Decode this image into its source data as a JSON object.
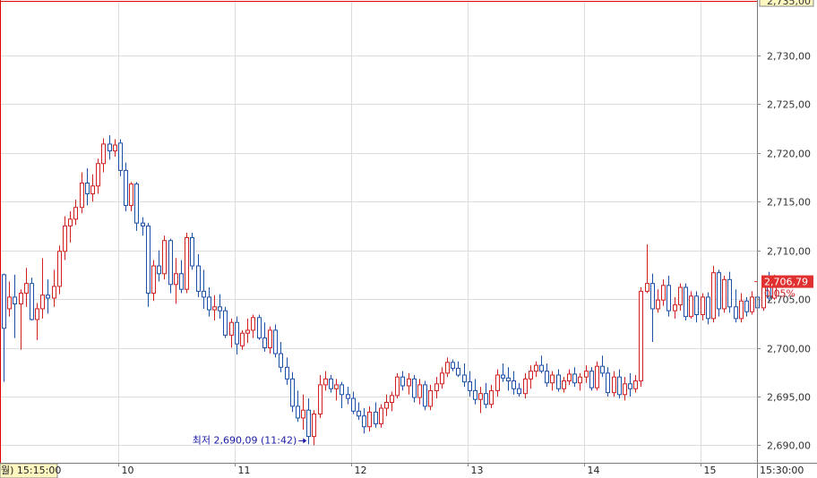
{
  "chart_data": {
    "type": "candlestick",
    "ylim": [
      2688.2,
      2735.5
    ],
    "y_ticks": [
      {
        "value": 2690,
        "label": "2,690,00"
      },
      {
        "value": 2695,
        "label": "2,695,00"
      },
      {
        "value": 2700,
        "label": "2,700,00"
      },
      {
        "value": 2705,
        "label": "2,705,00"
      },
      {
        "value": 2710,
        "label": "2,710,00"
      },
      {
        "value": 2715,
        "label": "2,715,00"
      },
      {
        "value": 2720,
        "label": "2,720,00"
      },
      {
        "value": 2725,
        "label": "2,725,00"
      },
      {
        "value": 2730,
        "label": "2,730,00"
      }
    ],
    "top_clipped_label": "2,735,00",
    "x_domain": [
      0,
      131
    ],
    "x_ticks": [
      {
        "index": 21,
        "label": "10"
      },
      {
        "index": 42,
        "label": "11"
      },
      {
        "index": 63,
        "label": "12"
      },
      {
        "index": 84,
        "label": "13"
      },
      {
        "index": 105,
        "label": "14"
      },
      {
        "index": 126,
        "label": "15"
      }
    ],
    "crosshair_time_label": "월) 15:15:00",
    "right_time_label": "15:30:00",
    "current_price": {
      "value": 2706.79,
      "label": "2,706,79",
      "change": "0.05%"
    },
    "min_annotation": {
      "index": 55,
      "value": 2690.09,
      "label": "최저 2,690,09 (11:42)"
    },
    "colors": {
      "up": "#d02020",
      "down": "#1c4fa8",
      "grid": "#dcdcdc",
      "frame": "#e00000",
      "price_tag_bg": "#e03030"
    },
    "series": [
      {
        "values": [
          [
            2707.5,
            2707.6,
            2696.5,
            2702.0
          ],
          [
            2704.0,
            2706.8,
            2703.2,
            2705.2
          ],
          [
            2705.2,
            2707.5,
            2701.0,
            2704.5
          ],
          [
            2704.5,
            2706.0,
            2699.8,
            2705.6
          ],
          [
            2705.6,
            2708.2,
            2704.2,
            2706.6
          ],
          [
            2706.6,
            2707.2,
            2702.8,
            2702.9
          ],
          [
            2702.9,
            2704.6,
            2700.8,
            2704.0
          ],
          [
            2704.0,
            2709.2,
            2703.0,
            2705.4
          ],
          [
            2705.4,
            2707.0,
            2703.5,
            2705.1
          ],
          [
            2705.1,
            2708.0,
            2704.2,
            2706.3
          ],
          [
            2706.3,
            2710.5,
            2705.5,
            2709.9
          ],
          [
            2709.9,
            2713.5,
            2709.0,
            2712.5
          ],
          [
            2712.5,
            2714.0,
            2710.8,
            2713.2
          ],
          [
            2713.2,
            2715.2,
            2712.6,
            2714.4
          ],
          [
            2714.4,
            2718.0,
            2713.8,
            2716.9
          ],
          [
            2716.9,
            2718.4,
            2714.6,
            2715.8
          ],
          [
            2715.8,
            2717.8,
            2715.0,
            2716.6
          ],
          [
            2716.6,
            2719.4,
            2715.8,
            2718.9
          ],
          [
            2718.9,
            2721.5,
            2718.0,
            2720.9
          ],
          [
            2720.9,
            2721.8,
            2719.3,
            2720.2
          ],
          [
            2720.2,
            2721.4,
            2719.6,
            2720.8
          ]
        ]
      },
      {
        "values": [
          [
            2721.0,
            2721.4,
            2717.6,
            2718.2
          ],
          [
            2718.2,
            2719.0,
            2714.0,
            2714.6
          ],
          [
            2714.6,
            2717.0,
            2714.0,
            2716.8
          ],
          [
            2716.8,
            2717.0,
            2712.0,
            2712.8
          ],
          [
            2712.8,
            2713.4,
            2711.5,
            2712.5
          ],
          [
            2712.5,
            2712.8,
            2704.2,
            2705.6
          ],
          [
            2705.6,
            2709.0,
            2704.8,
            2708.4
          ],
          [
            2708.4,
            2710.0,
            2706.8,
            2707.6
          ],
          [
            2707.6,
            2711.5,
            2707.0,
            2711.0
          ],
          [
            2711.0,
            2711.2,
            2705.6,
            2706.5
          ],
          [
            2706.5,
            2709.2,
            2704.5,
            2707.6
          ],
          [
            2707.6,
            2709.0,
            2705.6,
            2706.0
          ],
          [
            2706.0,
            2711.8,
            2705.6,
            2711.3
          ],
          [
            2711.3,
            2711.8,
            2708.0,
            2708.4
          ],
          [
            2708.4,
            2709.6,
            2705.2,
            2705.8
          ],
          [
            2705.8,
            2708.0,
            2704.0,
            2705.2
          ],
          [
            2705.2,
            2706.2,
            2703.2,
            2703.9
          ],
          [
            2703.9,
            2705.4,
            2702.8,
            2704.2
          ],
          [
            2704.2,
            2705.5,
            2703.0,
            2703.8
          ],
          [
            2703.8,
            2704.2,
            2701.0,
            2701.3
          ],
          [
            2701.3,
            2703.0,
            2700.0,
            2702.6
          ]
        ]
      },
      {
        "values": [
          [
            2702.6,
            2703.2,
            2699.3,
            2700.4
          ],
          [
            2700.2,
            2701.8,
            2699.8,
            2701.5
          ],
          [
            2701.5,
            2703.0,
            2700.5,
            2701.8
          ],
          [
            2701.8,
            2703.4,
            2701.0,
            2703.1
          ],
          [
            2703.1,
            2703.4,
            2700.8,
            2701.0
          ],
          [
            2701.0,
            2702.6,
            2699.6,
            2700.0
          ],
          [
            2700.0,
            2702.2,
            2699.4,
            2701.8
          ],
          [
            2701.8,
            2702.4,
            2699.0,
            2699.4
          ],
          [
            2699.4,
            2700.6,
            2697.5,
            2698.0
          ],
          [
            2698.0,
            2699.0,
            2696.2,
            2696.8
          ],
          [
            2696.8,
            2697.5,
            2693.4,
            2694.0
          ],
          [
            2694.0,
            2695.6,
            2692.4,
            2692.8
          ],
          [
            2692.8,
            2695.2,
            2691.6,
            2693.6
          ],
          [
            2693.6,
            2694.8,
            2690.1,
            2690.9
          ],
          [
            2690.9,
            2693.6,
            2690.0,
            2693.2
          ],
          [
            2693.2,
            2697.2,
            2692.8,
            2696.2
          ],
          [
            2696.2,
            2697.6,
            2695.6,
            2696.8
          ],
          [
            2696.8,
            2697.2,
            2695.4,
            2695.8
          ],
          [
            2695.8,
            2696.8,
            2694.6,
            2696.2
          ],
          [
            2696.2,
            2696.5,
            2693.8,
            2695.2
          ],
          [
            2695.2,
            2696.0,
            2694.2,
            2694.8
          ]
        ]
      },
      {
        "values": [
          [
            2694.8,
            2695.5,
            2693.2,
            2693.5
          ],
          [
            2693.5,
            2694.4,
            2692.6,
            2693.0
          ],
          [
            2693.0,
            2693.8,
            2691.2,
            2691.9
          ],
          [
            2691.9,
            2694.0,
            2691.4,
            2693.4
          ],
          [
            2693.4,
            2694.4,
            2691.8,
            2692.2
          ],
          [
            2692.2,
            2694.2,
            2691.8,
            2693.8
          ],
          [
            2693.8,
            2695.2,
            2693.0,
            2694.4
          ],
          [
            2694.4,
            2695.5,
            2693.5,
            2695.1
          ],
          [
            2695.1,
            2697.4,
            2694.8,
            2697.0
          ],
          [
            2697.0,
            2697.6,
            2695.6,
            2696.1
          ],
          [
            2696.1,
            2697.4,
            2695.2,
            2696.8
          ],
          [
            2696.8,
            2697.2,
            2694.4,
            2694.9
          ],
          [
            2694.9,
            2696.8,
            2694.2,
            2696.2
          ],
          [
            2696.2,
            2696.6,
            2693.6,
            2694.0
          ],
          [
            2694.0,
            2696.2,
            2693.6,
            2695.6
          ],
          [
            2695.6,
            2697.0,
            2694.8,
            2696.3
          ],
          [
            2696.3,
            2698.0,
            2695.8,
            2697.4
          ],
          [
            2697.4,
            2699.0,
            2697.0,
            2698.5
          ],
          [
            2698.5,
            2698.8,
            2697.6,
            2697.9
          ],
          [
            2697.9,
            2698.6,
            2697.0,
            2697.2
          ],
          [
            2697.2,
            2698.4,
            2696.0,
            2696.5
          ]
        ]
      },
      {
        "values": [
          [
            2696.5,
            2697.6,
            2695.0,
            2695.6
          ],
          [
            2695.6,
            2696.8,
            2694.2,
            2694.7
          ],
          [
            2694.7,
            2696.0,
            2693.3,
            2695.3
          ],
          [
            2695.3,
            2696.4,
            2693.8,
            2694.2
          ],
          [
            2694.2,
            2696.2,
            2693.8,
            2695.6
          ],
          [
            2695.6,
            2697.8,
            2695.0,
            2697.2
          ],
          [
            2697.2,
            2698.4,
            2696.5,
            2696.9
          ],
          [
            2696.9,
            2698.0,
            2695.6,
            2696.6
          ],
          [
            2696.6,
            2697.6,
            2695.2,
            2695.8
          ],
          [
            2695.8,
            2696.4,
            2695.0,
            2695.3
          ],
          [
            2695.3,
            2697.4,
            2694.8,
            2696.8
          ],
          [
            2696.8,
            2698.2,
            2695.8,
            2697.6
          ],
          [
            2697.6,
            2698.6,
            2697.0,
            2698.2
          ],
          [
            2698.2,
            2699.2,
            2697.4,
            2697.6
          ],
          [
            2697.6,
            2698.4,
            2696.0,
            2696.4
          ],
          [
            2696.4,
            2697.6,
            2695.6,
            2697.2
          ],
          [
            2697.2,
            2697.8,
            2695.5,
            2695.8
          ],
          [
            2695.8,
            2697.0,
            2695.4,
            2696.6
          ],
          [
            2696.6,
            2697.8,
            2696.2,
            2697.3
          ],
          [
            2697.3,
            2698.0,
            2696.0,
            2696.4
          ],
          [
            2696.4,
            2697.4,
            2695.6,
            2697.0
          ]
        ]
      },
      {
        "values": [
          [
            2697.0,
            2698.2,
            2696.4,
            2697.6
          ],
          [
            2697.6,
            2698.0,
            2695.6,
            2695.9
          ],
          [
            2695.9,
            2698.6,
            2695.6,
            2698.1
          ],
          [
            2698.1,
            2699.2,
            2697.0,
            2697.4
          ],
          [
            2697.4,
            2698.0,
            2695.0,
            2695.4
          ],
          [
            2695.4,
            2697.6,
            2695.0,
            2697.0
          ],
          [
            2697.0,
            2697.8,
            2694.8,
            2695.2
          ],
          [
            2695.2,
            2697.0,
            2694.6,
            2696.3
          ],
          [
            2696.3,
            2697.4,
            2695.0,
            2695.8
          ],
          [
            2695.8,
            2697.2,
            2695.4,
            2696.6
          ],
          [
            2696.6,
            2706.2,
            2696.0,
            2705.8
          ],
          [
            2705.8,
            2710.6,
            2705.6,
            2706.6
          ],
          [
            2706.6,
            2707.6,
            2700.6,
            2704.0
          ],
          [
            2704.0,
            2706.0,
            2703.6,
            2704.9
          ],
          [
            2704.9,
            2707.0,
            2704.3,
            2706.4
          ],
          [
            2706.4,
            2707.4,
            2703.2,
            2703.8
          ],
          [
            2703.8,
            2705.2,
            2703.0,
            2704.4
          ],
          [
            2704.4,
            2706.6,
            2703.8,
            2706.2
          ],
          [
            2706.2,
            2706.6,
            2702.8,
            2703.2
          ],
          [
            2703.2,
            2705.8,
            2703.0,
            2705.3
          ],
          [
            2705.3,
            2705.8,
            2702.6,
            2703.4
          ]
        ]
      },
      {
        "values": [
          [
            2703.4,
            2705.6,
            2702.8,
            2705.2
          ],
          [
            2705.2,
            2705.7,
            2702.4,
            2703.0
          ],
          [
            2703.0,
            2708.4,
            2702.6,
            2707.7
          ],
          [
            2707.7,
            2708.0,
            2703.2,
            2704.0
          ],
          [
            2704.0,
            2707.4,
            2703.6,
            2707.0
          ],
          [
            2707.0,
            2707.8,
            2703.6,
            2704.2
          ],
          [
            2704.2,
            2706.0,
            2702.6,
            2703.0
          ],
          [
            2703.0,
            2705.6,
            2702.6,
            2704.8
          ],
          [
            2704.8,
            2705.2,
            2703.2,
            2703.7
          ],
          [
            2703.7,
            2705.8,
            2703.4,
            2705.2
          ],
          [
            2705.2,
            2706.4,
            2703.6,
            2704.1
          ],
          [
            2704.1,
            2707.2,
            2703.8,
            2706.6
          ],
          [
            2706.6,
            2707.8,
            2704.8,
            2705.1
          ],
          [
            2705.1,
            2707.5,
            2704.9,
            2706.8
          ]
        ]
      }
    ]
  }
}
